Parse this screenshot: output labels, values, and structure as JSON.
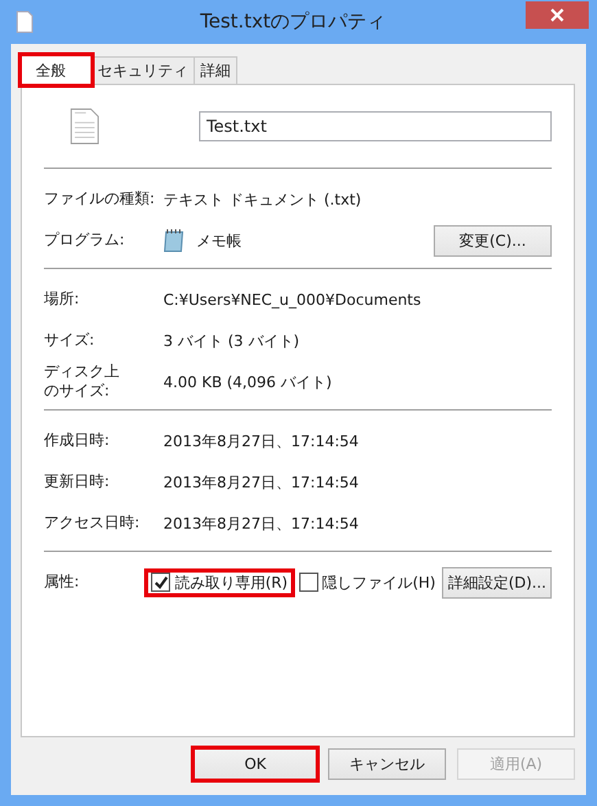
{
  "window": {
    "title": "Test.txtのプロパティ"
  },
  "tabs": [
    {
      "label": "全般",
      "selected": true,
      "highlighted": true
    },
    {
      "label": "セキュリティ",
      "selected": false,
      "highlighted": false
    },
    {
      "label": "詳細",
      "selected": false,
      "highlighted": false
    }
  ],
  "file_name": "Test.txt",
  "sections": [
    [
      {
        "kind": "text",
        "label": "ファイルの種類:",
        "value": "テキスト ドキュメント (.txt)"
      },
      {
        "kind": "program",
        "label": "プログラム:",
        "value": "メモ帳",
        "button": "変更(C)..."
      }
    ],
    [
      {
        "kind": "text",
        "label": "場所:",
        "value": "C:¥Users¥NEC_u_000¥Documents"
      },
      {
        "kind": "text",
        "label": "サイズ:",
        "value": "3 バイト (3 バイト)"
      },
      {
        "kind": "two_line",
        "label_lines": [
          "ディスク上",
          "のサイズ:"
        ],
        "value": "4.00 KB (4,096 バイト)"
      }
    ],
    [
      {
        "kind": "text",
        "label": "作成日時:",
        "value": "2013年8月27日、17:14:54"
      },
      {
        "kind": "text",
        "label": "更新日時:",
        "value": "2013年8月27日、17:14:54"
      },
      {
        "kind": "text",
        "label": "アクセス日時:",
        "value": "2013年8月27日、17:14:54"
      }
    ],
    [
      {
        "kind": "attributes",
        "label": "属性:",
        "checkboxes": [
          {
            "label": "読み取り専用(R)",
            "checked": true,
            "highlighted": true
          },
          {
            "label": "隠しファイル(H)",
            "checked": false,
            "highlighted": false
          }
        ],
        "button": "詳細設定(D)..."
      }
    ]
  ],
  "buttons": [
    {
      "label": "OK",
      "disabled": false,
      "highlighted": true
    },
    {
      "label": "キャンセル",
      "disabled": false,
      "highlighted": false
    },
    {
      "label": "適用(A)",
      "disabled": true,
      "highlighted": false
    }
  ]
}
